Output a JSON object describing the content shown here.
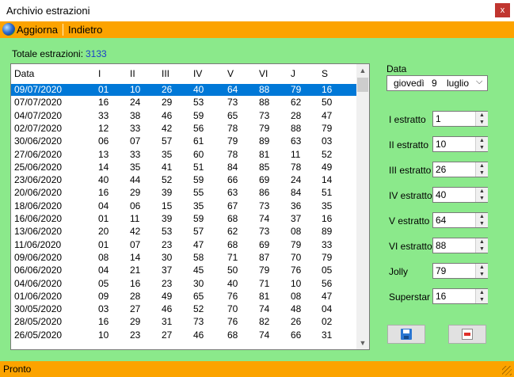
{
  "window": {
    "title": "Archivio estrazioni",
    "close_glyph": "x"
  },
  "menu": {
    "refresh_label": "Aggiorna",
    "back_label": "Indietro",
    "refresh_icon": "globe-icon"
  },
  "summary": {
    "label": "Totale estrazioni:",
    "value": "3133"
  },
  "table": {
    "columns": [
      "Data",
      "I",
      "II",
      "III",
      "IV",
      "V",
      "VI",
      "J",
      "S"
    ],
    "rows": [
      [
        "09/07/2020",
        "01",
        "10",
        "26",
        "40",
        "64",
        "88",
        "79",
        "16"
      ],
      [
        "07/07/2020",
        "16",
        "24",
        "29",
        "53",
        "73",
        "88",
        "62",
        "50"
      ],
      [
        "04/07/2020",
        "33",
        "38",
        "46",
        "59",
        "65",
        "73",
        "28",
        "47"
      ],
      [
        "02/07/2020",
        "12",
        "33",
        "42",
        "56",
        "78",
        "79",
        "88",
        "79"
      ],
      [
        "30/06/2020",
        "06",
        "07",
        "57",
        "61",
        "79",
        "89",
        "63",
        "03"
      ],
      [
        "27/06/2020",
        "13",
        "33",
        "35",
        "60",
        "78",
        "81",
        "11",
        "52"
      ],
      [
        "25/06/2020",
        "14",
        "35",
        "41",
        "51",
        "84",
        "85",
        "78",
        "49"
      ],
      [
        "23/06/2020",
        "40",
        "44",
        "52",
        "59",
        "66",
        "69",
        "24",
        "14"
      ],
      [
        "20/06/2020",
        "16",
        "29",
        "39",
        "55",
        "63",
        "86",
        "84",
        "51"
      ],
      [
        "18/06/2020",
        "04",
        "06",
        "15",
        "35",
        "67",
        "73",
        "36",
        "35"
      ],
      [
        "16/06/2020",
        "01",
        "11",
        "39",
        "59",
        "68",
        "74",
        "37",
        "16"
      ],
      [
        "13/06/2020",
        "20",
        "42",
        "53",
        "57",
        "62",
        "73",
        "08",
        "89"
      ],
      [
        "11/06/2020",
        "01",
        "07",
        "23",
        "47",
        "68",
        "69",
        "79",
        "33"
      ],
      [
        "09/06/2020",
        "08",
        "14",
        "30",
        "58",
        "71",
        "87",
        "70",
        "79"
      ],
      [
        "06/06/2020",
        "04",
        "21",
        "37",
        "45",
        "50",
        "79",
        "76",
        "05"
      ],
      [
        "04/06/2020",
        "05",
        "16",
        "23",
        "30",
        "40",
        "71",
        "10",
        "56"
      ],
      [
        "01/06/2020",
        "09",
        "28",
        "49",
        "65",
        "76",
        "81",
        "08",
        "47"
      ],
      [
        "30/05/2020",
        "03",
        "27",
        "46",
        "52",
        "70",
        "74",
        "48",
        "04"
      ],
      [
        "28/05/2020",
        "16",
        "29",
        "31",
        "73",
        "76",
        "82",
        "26",
        "02"
      ],
      [
        "26/05/2020",
        "10",
        "23",
        "27",
        "46",
        "68",
        "74",
        "66",
        "31"
      ]
    ]
  },
  "form": {
    "date_label": "Data",
    "date": {
      "weekday": "giovedì",
      "day": "9",
      "month": "luglio"
    },
    "fields": [
      {
        "label": "I estratto",
        "value": "1"
      },
      {
        "label": "II estratto",
        "value": "10"
      },
      {
        "label": "III estratto",
        "value": "26"
      },
      {
        "label": "IV estratto",
        "value": "40"
      },
      {
        "label": "V estratto",
        "value": "64"
      },
      {
        "label": "VI estratto",
        "value": "88"
      },
      {
        "label": "Jolly",
        "value": "79"
      },
      {
        "label": "Superstar",
        "value": "16"
      }
    ]
  },
  "buttons": {
    "save_icon": "save-icon",
    "delete_icon": "delete-icon"
  },
  "status": {
    "text": "Pronto"
  },
  "colors": {
    "accent": "#fca300",
    "background": "#8be98b",
    "selection": "#0078d7",
    "total_value": "#1a3fc8"
  }
}
